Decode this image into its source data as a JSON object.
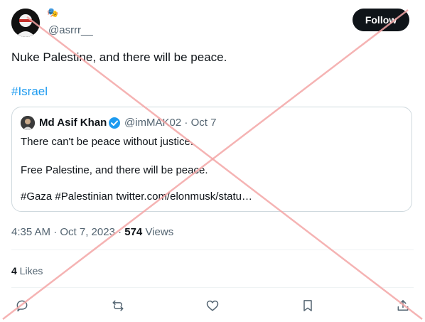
{
  "author": {
    "display_emoji": "🎭",
    "handle": "@asrrr__",
    "follow_label": "Follow"
  },
  "tweet": {
    "text": "Nuke Palestine, and there will be peace.",
    "hashtag": "#Israel"
  },
  "quoted": {
    "name": "Md Asif Khan",
    "handle_date": "@imMAK02 · Oct 7",
    "line1": "There can't be peace without justice.",
    "line2": "Free Palestine, and there will be peace.",
    "line3": "#Gaza #Palestinian twitter.com/elonmusk/statu…"
  },
  "meta": {
    "time_date": "4:35 AM · Oct 7, 2023 · ",
    "views_count": "574",
    "views_label": " Views"
  },
  "stats": {
    "likes_count": "4",
    "likes_label": " Likes"
  },
  "icons": {
    "reply": "reply-icon",
    "retweet": "retweet-icon",
    "like": "heart-icon",
    "bookmark": "bookmark-icon",
    "share": "share-icon"
  },
  "colors": {
    "accent": "#1d9bf0",
    "overlay_cross": "#f4a6a6"
  }
}
